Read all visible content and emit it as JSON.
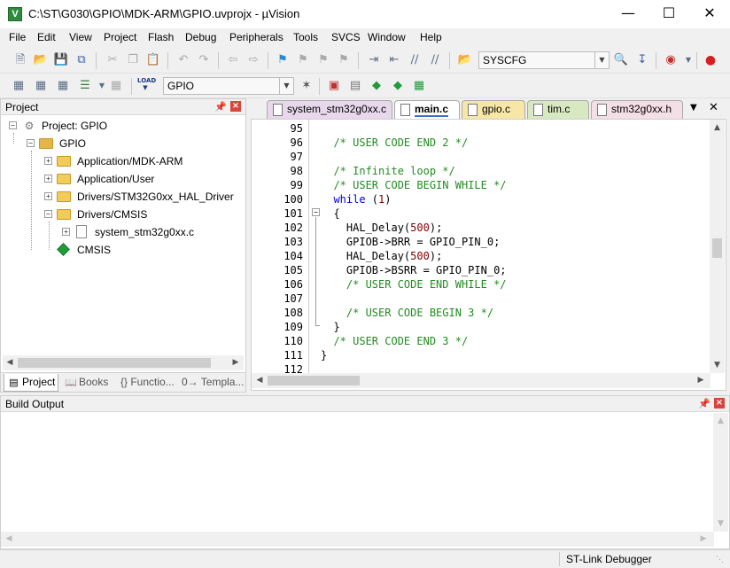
{
  "window": {
    "title": "C:\\ST\\G030\\GPIO\\MDK-ARM\\GPIO.uvprojx  -  µVision",
    "app_icon": "V",
    "minimize": "—",
    "maximize": "☐",
    "close": "✕"
  },
  "menu": [
    "File",
    "Edit",
    "View",
    "Project",
    "Flash",
    "Debug",
    "Peripherals",
    "Tools",
    "SVCS",
    "Window",
    "Help"
  ],
  "toolbar": {
    "config_value": "SYSCFG",
    "target_value": "GPIO",
    "load_label": "LOAD"
  },
  "project_pane": {
    "title": "Project",
    "pin": "▕",
    "close": "×",
    "tree": {
      "root": "Project: GPIO",
      "target": "GPIO",
      "groups": [
        "Application/MDK-ARM",
        "Application/User",
        "Drivers/STM32G0xx_HAL_Driver",
        "Drivers/CMSIS"
      ],
      "file": "system_stm32g0xx.c",
      "cmsis": "CMSIS"
    },
    "tabs": [
      "Project",
      "Books",
      "{} Functio...",
      "0→ Templa..."
    ]
  },
  "editor": {
    "tabs": [
      "system_stm32g0xx.c",
      "main.c",
      "gpio.c",
      "tim.c",
      "stm32g0xx.h"
    ],
    "tab_colors": [
      "#e8d8ec",
      "#ffffff",
      "#f7e7a6",
      "#d8e8c0",
      "#f4dfe6"
    ],
    "active_tab": "main.c",
    "lines": [
      {
        "n": "95",
        "text": ""
      },
      {
        "n": "96",
        "text": "  /* USER CODE END 2 */"
      },
      {
        "n": "97",
        "text": ""
      },
      {
        "n": "98",
        "text": "  /* Infinite loop */"
      },
      {
        "n": "99",
        "text": "  /* USER CODE BEGIN WHILE */"
      },
      {
        "n": "100",
        "text": "  while (1)"
      },
      {
        "n": "101",
        "text": "  {"
      },
      {
        "n": "102",
        "text": "    HAL_Delay(500);"
      },
      {
        "n": "103",
        "text": "    GPIOB->BRR = GPIO_PIN_0;"
      },
      {
        "n": "104",
        "text": "    HAL_Delay(500);"
      },
      {
        "n": "105",
        "text": "    GPIOB->BSRR = GPIO_PIN_0;"
      },
      {
        "n": "106",
        "text": "    /* USER CODE END WHILE */"
      },
      {
        "n": "107",
        "text": ""
      },
      {
        "n": "108",
        "text": "    /* USER CODE BEGIN 3 */"
      },
      {
        "n": "109",
        "text": "  }"
      },
      {
        "n": "110",
        "text": "  /* USER CODE END 3 */"
      },
      {
        "n": "111",
        "text": "}"
      },
      {
        "n": "112",
        "text": ""
      }
    ]
  },
  "build_output": {
    "title": "Build Output"
  },
  "status": {
    "debugger": "ST-Link Debugger"
  }
}
